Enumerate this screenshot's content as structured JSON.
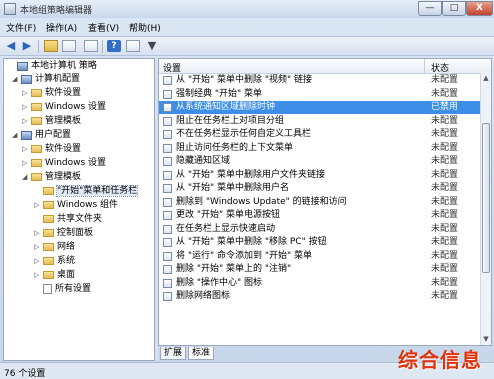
{
  "window": {
    "title": "本地组策略编辑器",
    "controls": {
      "minimize": "—",
      "maximize": "□",
      "close": "X"
    }
  },
  "menu": [
    "文件(F)",
    "操作(A)",
    "查看(V)",
    "帮助(H)"
  ],
  "tree": [
    {
      "label": "本地计算机 策略",
      "icon": "computer-icon",
      "expander": ""
    },
    {
      "label": "计算机配置",
      "icon": "computer-icon",
      "expander": "◢"
    },
    {
      "label": "软件设置",
      "icon": "folder-icon",
      "expander": "▷"
    },
    {
      "label": "Windows 设置",
      "icon": "folder-icon",
      "expander": "▷"
    },
    {
      "label": "管理模板",
      "icon": "folder-icon",
      "expander": "▷"
    },
    {
      "label": "用户配置",
      "icon": "computer-icon",
      "expander": "◢"
    },
    {
      "label": "软件设置",
      "icon": "folder-icon",
      "expander": "▷"
    },
    {
      "label": "Windows 设置",
      "icon": "folder-icon",
      "expander": "▷"
    },
    {
      "label": "管理模板",
      "icon": "folder-icon",
      "expander": "◢"
    },
    {
      "label": "\"开始\"菜单和任务栏",
      "icon": "folder-icon",
      "expander": "",
      "selected": true
    },
    {
      "label": "Windows 组件",
      "icon": "folder-icon",
      "expander": "▷"
    },
    {
      "label": "共享文件夹",
      "icon": "folder-icon",
      "expander": ""
    },
    {
      "label": "控制面板",
      "icon": "folder-icon",
      "expander": "▷"
    },
    {
      "label": "网络",
      "icon": "folder-icon",
      "expander": "▷"
    },
    {
      "label": "系统",
      "icon": "folder-icon",
      "expander": "▷"
    },
    {
      "label": "桌面",
      "icon": "folder-icon",
      "expander": "▷"
    },
    {
      "label": "所有设置",
      "icon": "settings-doc-icon",
      "expander": ""
    }
  ],
  "list": {
    "columns": {
      "setting": "设置",
      "state": "状态"
    },
    "rows": [
      {
        "name": "从 \"开始\" 菜单中删除 \"视频\" 链接",
        "state": "未配置"
      },
      {
        "name": "强制经典 \"开始\" 菜单",
        "state": "未配置"
      },
      {
        "name": "从系统通知区域删除时钟",
        "state": "已禁用",
        "selected": true
      },
      {
        "name": "阻止在任务栏上对项目分组",
        "state": "未配置"
      },
      {
        "name": "不在任务栏显示任何自定义工具栏",
        "state": "未配置"
      },
      {
        "name": "阻止访问任务栏的上下文菜单",
        "state": "未配置"
      },
      {
        "name": "隐藏通知区域",
        "state": "未配置"
      },
      {
        "name": "从 \"开始\" 菜单中删除用户文件夹链接",
        "state": "未配置"
      },
      {
        "name": "从 \"开始\" 菜单中删除用户名",
        "state": "未配置"
      },
      {
        "name": "删除到 \"Windows Update\" 的链接和访问",
        "state": "未配置"
      },
      {
        "name": "更改 \"开始\" 菜单电源按钮",
        "state": "未配置"
      },
      {
        "name": "在任务栏上显示快速启动",
        "state": "未配置"
      },
      {
        "name": "从 \"开始\" 菜单中删除 \"移除 PC\" 按钮",
        "state": "未配置"
      },
      {
        "name": "将 \"运行\" 命令添加到 \"开始\" 菜单",
        "state": "未配置"
      },
      {
        "name": "删除 \"开始\" 菜单上的 \"注销\"",
        "state": "未配置"
      },
      {
        "name": "删除 \"操作中心\" 图标",
        "state": "未配置"
      },
      {
        "name": "删除网络图标",
        "state": "未配置"
      }
    ]
  },
  "tabs": [
    "扩展",
    "标准"
  ],
  "status": "76 个设置",
  "watermark": "综合信息",
  "colors": {
    "selection": "#3d8ee6",
    "watermark": "#e0320b"
  }
}
